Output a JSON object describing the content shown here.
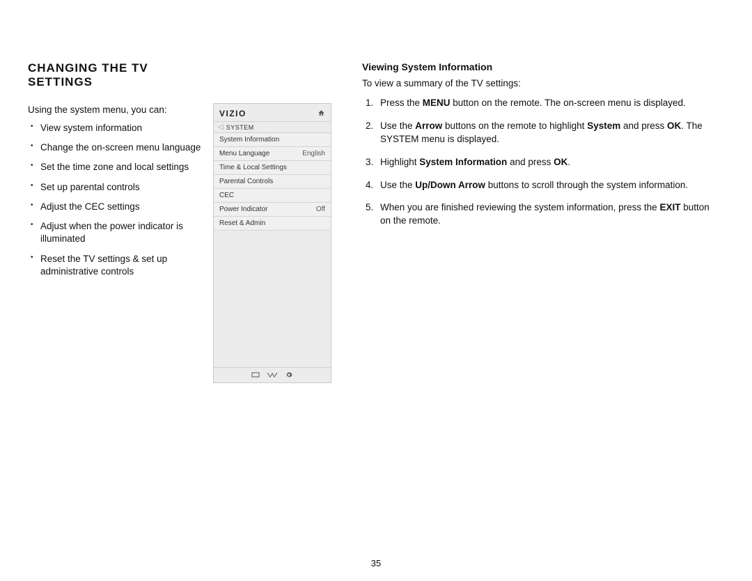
{
  "left": {
    "heading": "CHANGING THE TV SETTINGS",
    "intro": "Using the system menu, you can:",
    "bullets": [
      "View system information",
      "Change the on-screen menu language",
      "Set the time zone and local settings",
      "Set up parental controls",
      "Adjust the CEC settings",
      "Adjust when the power indicator is illuminated",
      "Reset the TV settings & set up administrative controls"
    ]
  },
  "tv_menu": {
    "brand": "VIZIO",
    "crumb": "SYSTEM",
    "rows": [
      {
        "label": "System Information",
        "value": ""
      },
      {
        "label": "Menu Language",
        "value": "English"
      },
      {
        "label": "Time & Local Settings",
        "value": ""
      },
      {
        "label": "Parental Controls",
        "value": ""
      },
      {
        "label": "CEC",
        "value": ""
      },
      {
        "label": "Power Indicator",
        "value": "Off"
      },
      {
        "label": "Reset & Admin",
        "value": ""
      }
    ]
  },
  "right": {
    "subhead": "Viewing System Information",
    "intro": "To view a summary of the TV settings:",
    "steps": [
      {
        "pre": "Press the ",
        "b1": "MENU",
        "mid": " button on the remote. The on-screen menu is displayed.",
        "b2": "",
        "post": ""
      },
      {
        "pre": "Use the ",
        "b1": "Arrow",
        "mid": " buttons on the remote to highlight ",
        "b2": "System",
        "post": " and press ",
        "b3": "OK",
        "tail": ". The SYSTEM menu is displayed."
      },
      {
        "pre": "Highlight ",
        "b1": "System Information",
        "mid": " and press ",
        "b2": "OK",
        "post": "."
      },
      {
        "pre": "Use the ",
        "b1": "Up/Down Arrow",
        "mid": " buttons to scroll through the system information.",
        "b2": "",
        "post": ""
      },
      {
        "pre": "When you are finished reviewing the system information, press the ",
        "b1": "EXIT",
        "mid": " button on the remote.",
        "b2": "",
        "post": ""
      }
    ]
  },
  "page_number": "35"
}
